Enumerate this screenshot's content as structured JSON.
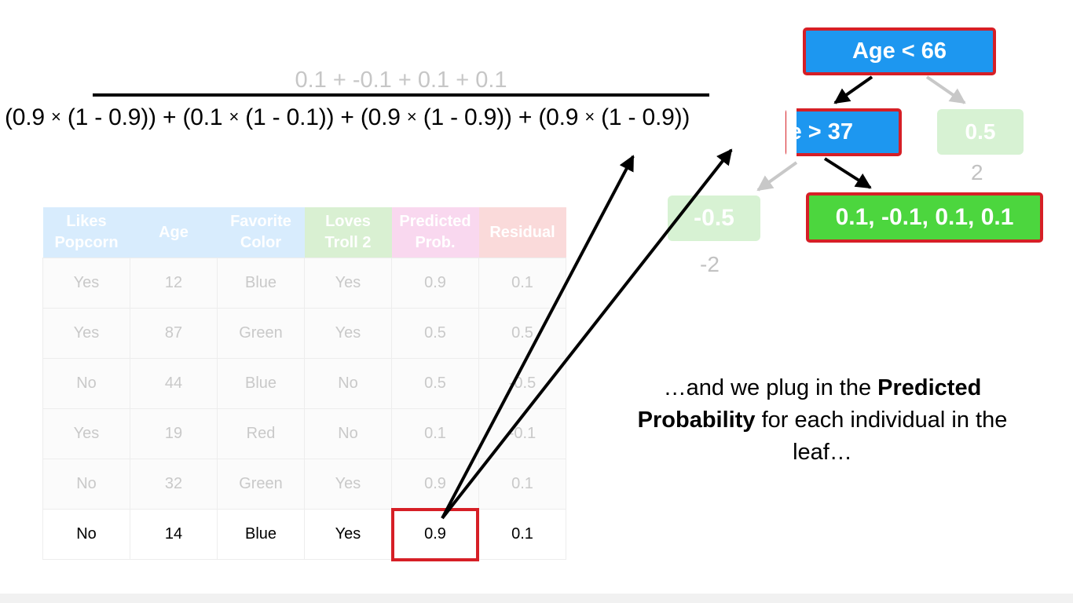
{
  "formula": {
    "numerator": "0.1 + -0.1 + 0.1 + 0.1",
    "denominator_terms": [
      {
        "p": "0.9",
        "q": "0.9"
      },
      {
        "p": "0.1",
        "q": "0.1"
      },
      {
        "p": "0.9",
        "q": "0.9"
      },
      {
        "p": "0.9",
        "q": "0.9"
      }
    ],
    "times_symbol": "×",
    "plus_symbol": "+"
  },
  "table": {
    "headers": [
      {
        "line1": "Likes",
        "line2": "Popcorn"
      },
      {
        "line1": "Age",
        "line2": ""
      },
      {
        "line1": "Favorite",
        "line2": "Color"
      },
      {
        "line1": "Loves",
        "line2": "Troll 2"
      },
      {
        "line1": "Predicted",
        "line2": "Prob."
      },
      {
        "line1": "Residual",
        "line2": ""
      }
    ],
    "rows": [
      [
        "Yes",
        "12",
        "Blue",
        "Yes",
        "0.9",
        "0.1"
      ],
      [
        "Yes",
        "87",
        "Green",
        "Yes",
        "0.5",
        "0.5"
      ],
      [
        "No",
        "44",
        "Blue",
        "No",
        "0.5",
        "-0.5"
      ],
      [
        "Yes",
        "19",
        "Red",
        "No",
        "0.1",
        "-0.1"
      ],
      [
        "No",
        "32",
        "Green",
        "Yes",
        "0.9",
        "0.1"
      ],
      [
        "No",
        "14",
        "Blue",
        "Yes",
        "0.9",
        "0.1"
      ]
    ]
  },
  "tree": {
    "root_label": "Age < 66",
    "mid_label": "e > 37",
    "right_leaf_label": "0.5",
    "right_leaf_value": "2",
    "left_leaf_label": "-0.5",
    "left_leaf_value": "-2",
    "active_leaf_label": "0.1, -0.1, 0.1, 0.1"
  },
  "caption": {
    "prefix": "…and we plug in the ",
    "bold1": "Predicted",
    "bold2": "Probability",
    "suffix": " for each individual in the leaf…"
  },
  "colors": {
    "node_blue": "#1d97f0",
    "leaf_green": "#4cd63e",
    "highlight_red": "#d61f26"
  }
}
